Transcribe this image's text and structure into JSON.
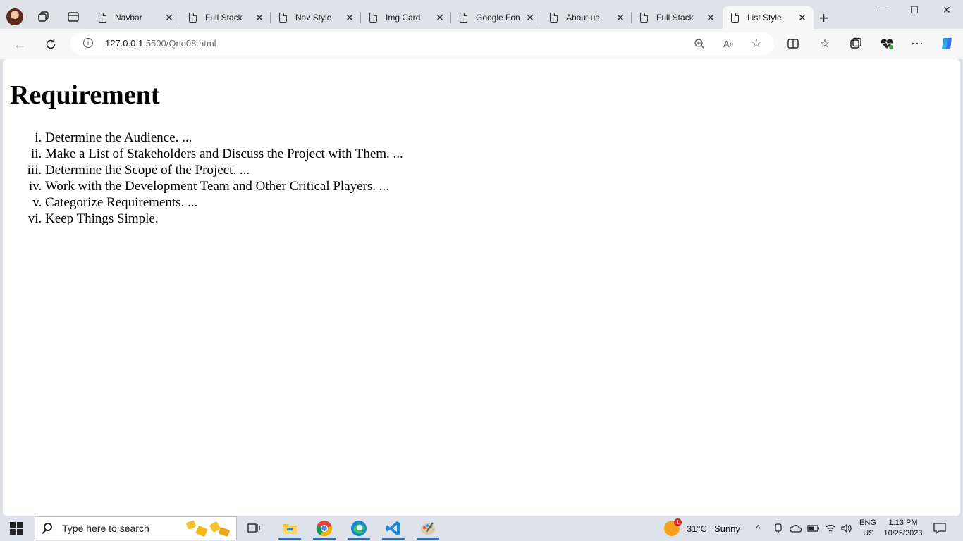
{
  "tabs": [
    {
      "title": "Navbar"
    },
    {
      "title": "Full Stack"
    },
    {
      "title": "Nav Style"
    },
    {
      "title": "Img Card"
    },
    {
      "title": "Google Fon"
    },
    {
      "title": "About us"
    },
    {
      "title": "Full Stack"
    },
    {
      "title": "List Style"
    }
  ],
  "address": {
    "host": "127.0.0.1",
    "path": ":5500/Qno08.html"
  },
  "page": {
    "heading": "Requirement",
    "items": [
      "Determine the Audience. ...",
      "Make a List of Stakeholders and Discuss the Project with Them. ...",
      "Determine the Scope of the Project. ...",
      "Work with the Development Team and Other Critical Players. ...",
      "Categorize Requirements. ...",
      "Keep Things Simple."
    ]
  },
  "taskbar": {
    "search_placeholder": "Type here to search",
    "weather_badge": "1",
    "weather_temp": "31°C",
    "weather_text": "Sunny",
    "lang_top": "ENG",
    "lang_bottom": "US",
    "time": "1:13 PM",
    "date": "10/25/2023"
  },
  "colors": {
    "accent": "#1e6fd0",
    "tabstrip": "#dfe3e8",
    "page": "#ffffff"
  }
}
